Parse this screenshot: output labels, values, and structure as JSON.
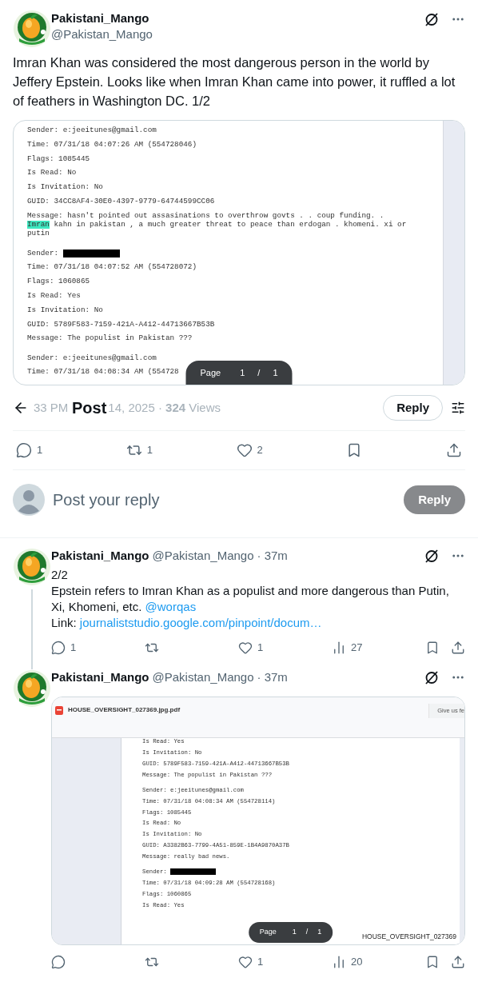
{
  "main_post": {
    "author": {
      "name": "Pakistani_Mango",
      "handle": "@Pakistan_Mango"
    },
    "text": "Imran Khan was considered the most dangerous person in the world by Jeffery Epstein. Looks like when Imran Khan came into power, it ruffled a lot of feathers in Washington DC. 1/2",
    "document": {
      "blocks": [
        [
          {
            "text": "Sender: e:jeeitunes@gmail.com"
          },
          {
            "text": "Time: 07/31/18 04:07:26 AM (554728046)"
          },
          {
            "text": "Flags: 1085445"
          },
          {
            "text": "Is Read: No"
          },
          {
            "text": "Is Invitation: No"
          },
          {
            "text": "GUID: 34CC8AF4-30E0-4397-9779-64744599CC06"
          },
          {
            "text": "Message: hasn't pointed out assasinations to overthrow govts . . coup funding. .",
            "wrapped": [
              {
                "highlight": "Imran",
                "text": " kahn in pakistan , a much greater threat to peace than erdogan . khomeni. xi or"
              },
              {
                "text": "putin"
              }
            ]
          }
        ],
        [
          {
            "text": "Sender: ",
            "redacted": true
          },
          {
            "text": "Time: 07/31/18 04:07:52 AM (554728072)"
          },
          {
            "text": "Flags: 1060865"
          },
          {
            "text": "Is Read: Yes"
          },
          {
            "text": "Is Invitation: No"
          },
          {
            "text": "GUID: 5789F583-7159-421A-A412-44713667B53B"
          },
          {
            "text": "Message: The populist in Pakistan ???"
          }
        ],
        [
          {
            "text": "Sender: e:jeeitunes@gmail.com"
          },
          {
            "text": "Time: 07/31/18 04:08:34 AM (554728"
          }
        ]
      ],
      "page_indicator": {
        "label": "Page",
        "current": "1",
        "separator": "/",
        "total": "1"
      }
    },
    "meta": {
      "time": "33 PM",
      "date": "14, 2025 · ",
      "views_count": "324",
      "views_label": " Views"
    },
    "stats": {
      "replies": "1",
      "reposts": "1",
      "likes": "2"
    }
  },
  "top_bar": {
    "title": "Post",
    "reply_button": "Reply"
  },
  "reply_box": {
    "placeholder": "Post your reply",
    "button": {
      "label": "Reply",
      "disabled": true
    }
  },
  "thread": [
    {
      "author": {
        "name": "Pakistani_Mango",
        "handle": "@Pakistan_Mango"
      },
      "time": "· 37m",
      "paragraphs": [
        {
          "text": "2/2"
        },
        {
          "text": "Epstein refers to Imran Khan as a populist and more dangerous than Putin, Xi, Khomeni, etc. ",
          "mention": "@worqas"
        },
        {
          "text": "Link: ",
          "link": "journaliststudio.google.com/pinpoint/docum…"
        }
      ],
      "stats": {
        "replies": "1",
        "likes": "1",
        "views": "27"
      }
    },
    {
      "author": {
        "name": "Pakistani_Mango",
        "handle": "@Pakistan_Mango"
      },
      "time": "· 37m",
      "document": {
        "filename": "HOUSE_OVERSIGHT_027369.jpg.pdf",
        "feedback_button": "Give us fe",
        "footer": "HOUSE_OVERSIGHT_027369",
        "blocks": [
          [
            {
              "text": "Is Read: Yes"
            },
            {
              "text": "Is Invitation: No"
            },
            {
              "text": "GUID: 5789F583-7159-421A-A412-44713667B53B"
            },
            {
              "text": "Message: The populist in Pakistan ???"
            }
          ],
          [
            {
              "text": "Sender: e:jeeitunes@gmail.com"
            },
            {
              "text": "Time: 07/31/18 04:08:34 AM (554728114)"
            },
            {
              "text": "Flags: 1085445"
            },
            {
              "text": "Is Read: No"
            },
            {
              "text": "Is Invitation: No"
            },
            {
              "text": "GUID: A3382B63-7799-4A51-859E-1B4A9870A37B"
            },
            {
              "text": "Message: really bad news."
            }
          ],
          [
            {
              "text": "Sender: ",
              "redacted": true
            },
            {
              "text": "Time: 07/31/18 04:09:28 AM (554728168)"
            },
            {
              "text": "Flags: 1060865"
            },
            {
              "text": "Is Read: Yes"
            }
          ]
        ],
        "page_indicator": {
          "label": "Page",
          "current": "1",
          "separator": "/",
          "total": "1"
        }
      },
      "stats": {
        "likes": "1",
        "views": "20"
      }
    }
  ]
}
